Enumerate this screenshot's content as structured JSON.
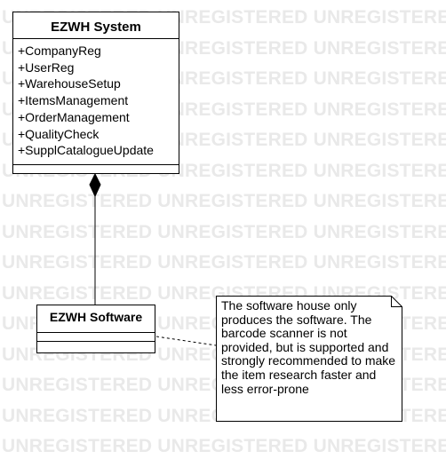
{
  "watermark": {
    "text": "UNREGISTERED",
    "color": "#e9e9e9"
  },
  "classes": {
    "system": {
      "name": "EZWH System",
      "operations": [
        "+CompanyReg",
        "+UserReg",
        "+WarehouseSetup",
        "+ItemsManagement",
        "+OrderManagement",
        "+QualityCheck",
        "+SupplCatalogueUpdate"
      ]
    },
    "software": {
      "name": "EZWH Software"
    }
  },
  "note": {
    "text": "The software house only produces the software. The barcode scanner is not provided, but is supported and strongly recommended to make the item research faster and less error-prone"
  },
  "relations": [
    {
      "type": "composition",
      "from": "EZWH System",
      "to": "EZWH Software"
    },
    {
      "type": "note-anchor",
      "from": "EZWH Software",
      "to": "note"
    }
  ]
}
